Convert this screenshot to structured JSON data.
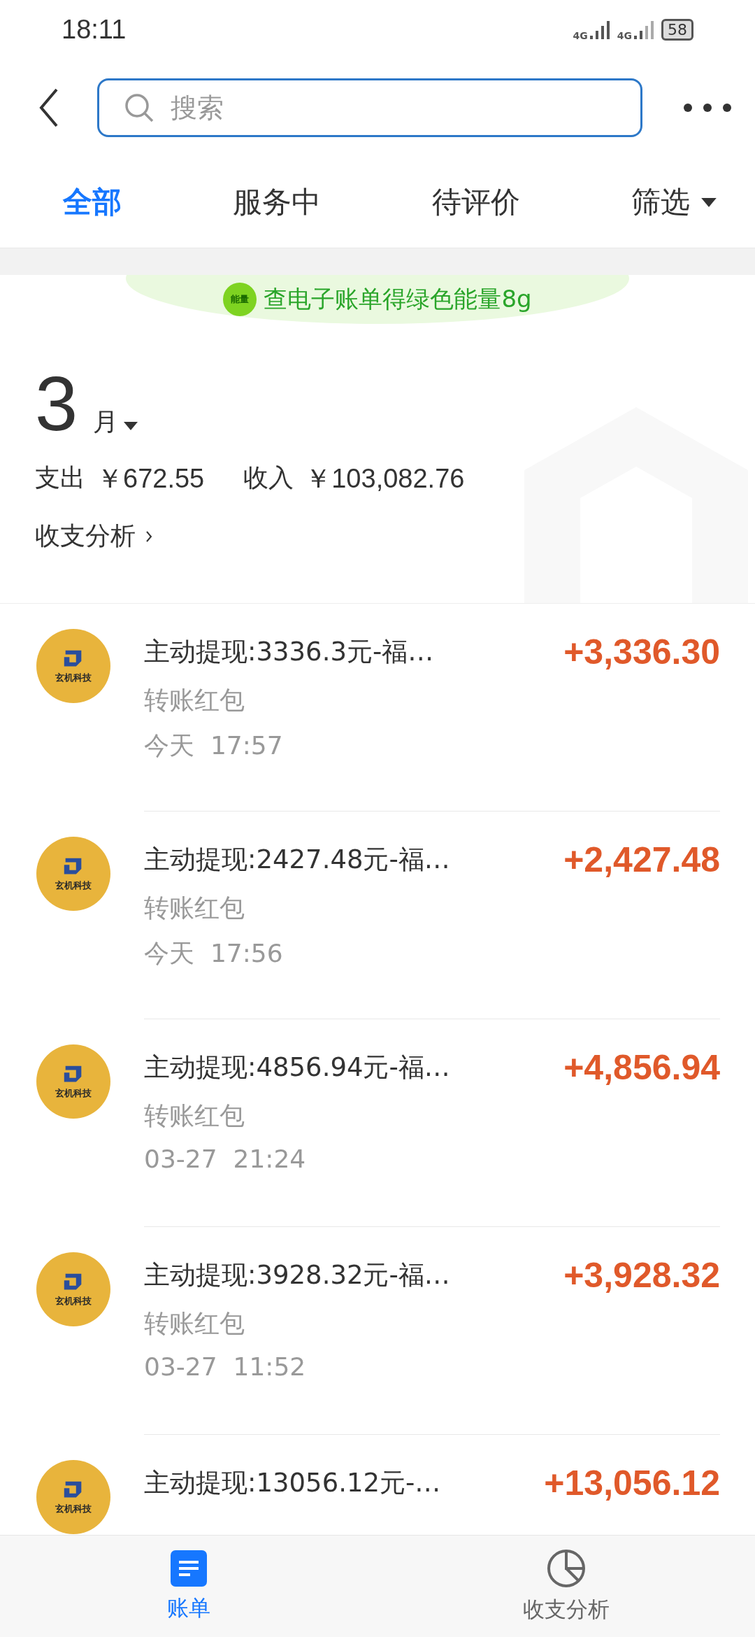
{
  "status_bar": {
    "time": "18:11",
    "network_1": "4G",
    "network_2": "4G",
    "battery": "58"
  },
  "search": {
    "placeholder": "搜索"
  },
  "tabs": [
    {
      "label": "全部",
      "selected": true,
      "kind": "plain"
    },
    {
      "label": "服务中",
      "selected": false,
      "kind": "plain"
    },
    {
      "label": "待评价",
      "selected": false,
      "kind": "plain"
    },
    {
      "label": "筛选",
      "selected": false,
      "kind": "dropdown"
    }
  ],
  "banner": {
    "badge": "能量",
    "text": "查电子账单得绿色能量8g"
  },
  "month": {
    "number": "3",
    "unit": "月"
  },
  "summary": {
    "expense_label": "支出",
    "expense": "￥672.55",
    "income_label": "收入",
    "income": "￥103,082.76",
    "analysis_link": "收支分析"
  },
  "transactions": [
    {
      "logo_text": "玄机科技",
      "title": "主动提现:3336.3元-福…",
      "amount": "+3,336.30",
      "category": "转账红包",
      "day": "今天",
      "time": "17:57"
    },
    {
      "logo_text": "玄机科技",
      "title": "主动提现:2427.48元-福…",
      "amount": "+2,427.48",
      "category": "转账红包",
      "day": "今天",
      "time": "17:56"
    },
    {
      "logo_text": "玄机科技",
      "title": "主动提现:4856.94元-福…",
      "amount": "+4,856.94",
      "category": "转账红包",
      "day": "03-27",
      "time": "21:24"
    },
    {
      "logo_text": "玄机科技",
      "title": "主动提现:3928.32元-福…",
      "amount": "+3,928.32",
      "category": "转账红包",
      "day": "03-27",
      "time": "11:52"
    },
    {
      "logo_text": "玄机科技",
      "title": "主动提现:13056.12元-…",
      "amount": "+13,056.12"
    }
  ],
  "bottom_nav": [
    {
      "label": "账单",
      "selected": true,
      "kind": "bill"
    },
    {
      "label": "收支分析",
      "selected": false,
      "kind": "pie"
    }
  ]
}
